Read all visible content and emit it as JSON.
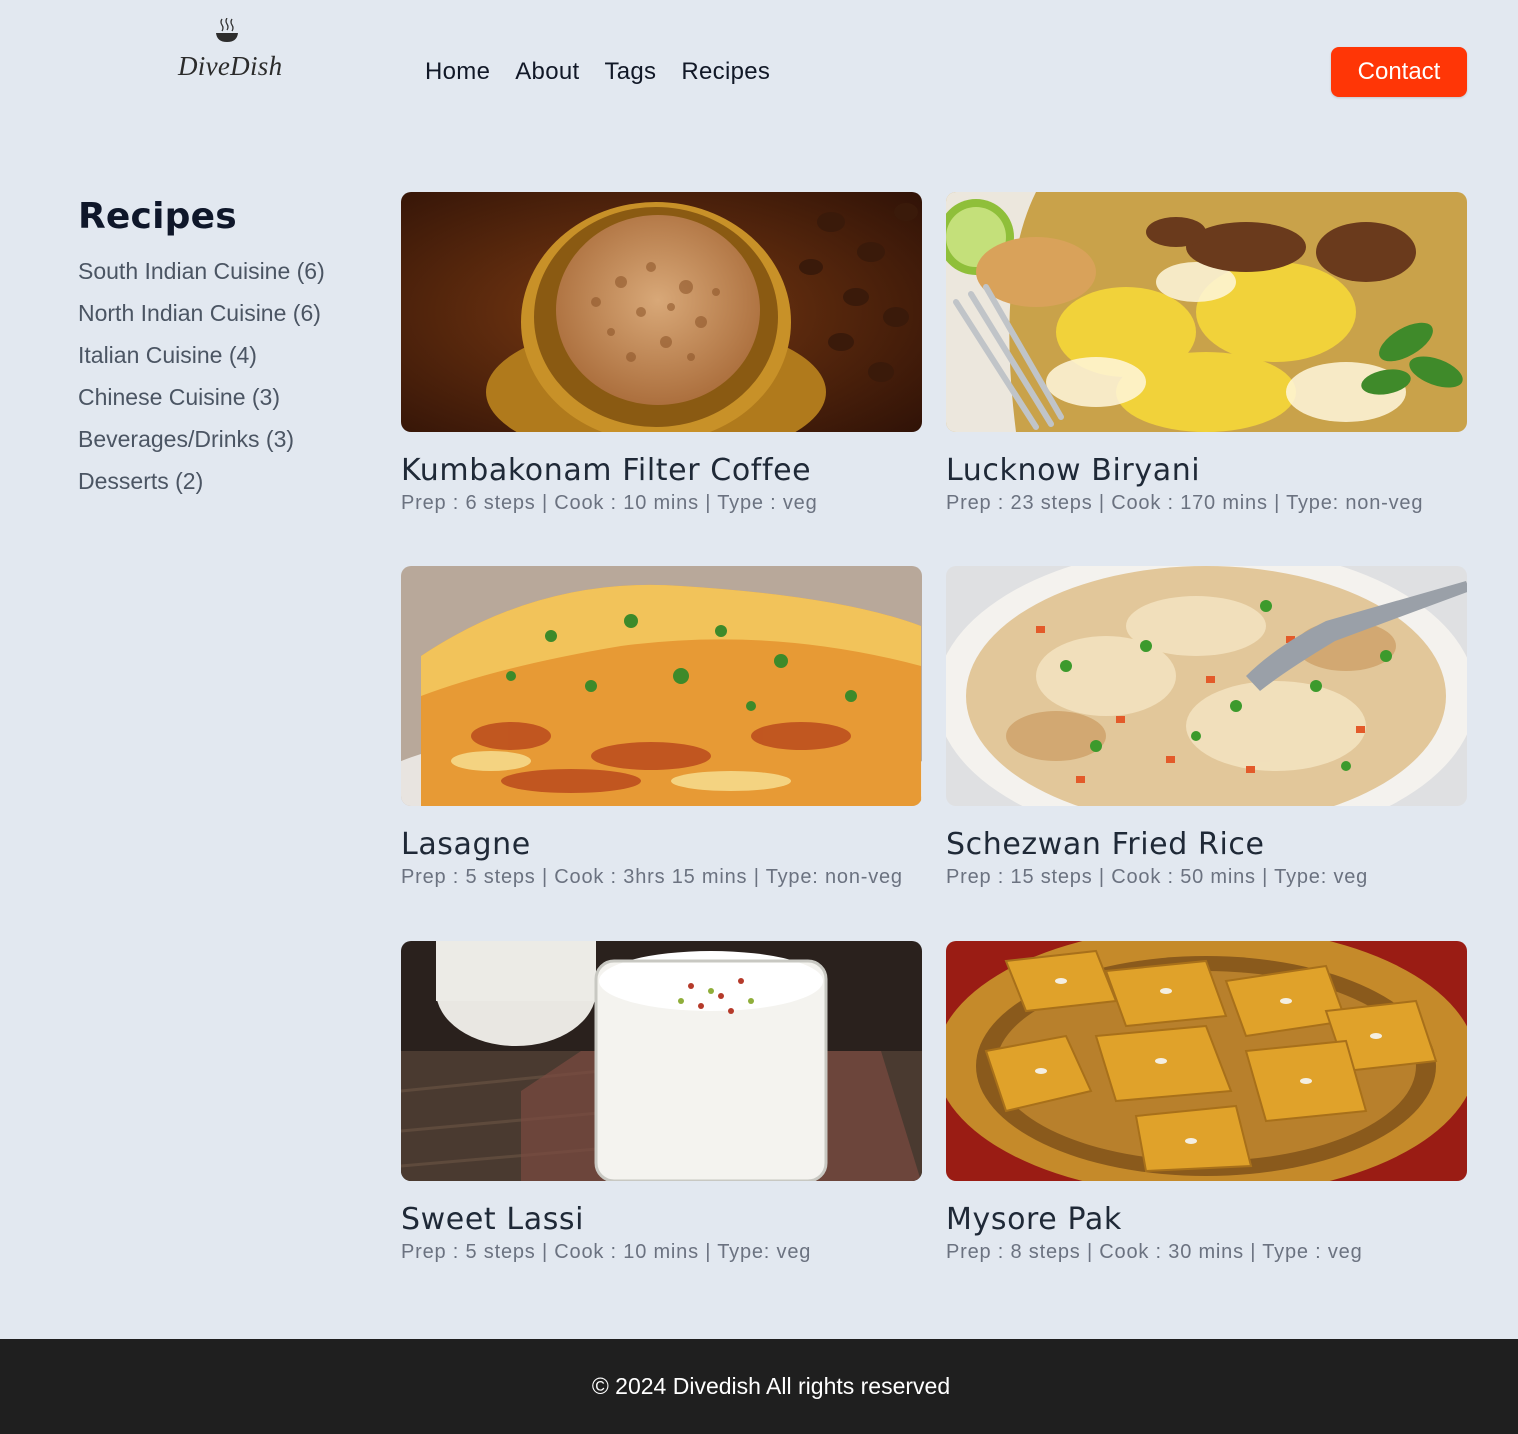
{
  "header": {
    "logo_text": "DiveDish",
    "nav": [
      "Home",
      "About",
      "Tags",
      "Recipes"
    ],
    "contact_label": "Contact"
  },
  "sidebar": {
    "title": "Recipes",
    "categories": [
      "South Indian Cuisine (6)",
      "North Indian Cuisine (6)",
      "Italian Cuisine (4)",
      "Chinese Cuisine (3)",
      "Beverages/Drinks (3)",
      "Desserts (2)"
    ]
  },
  "recipes": [
    {
      "title": "Kumbakonam Filter Coffee",
      "meta": "Prep : 6 steps | Cook : 10 mins | Type : veg",
      "image": "filter-coffee-image"
    },
    {
      "title": "Lucknow Biryani",
      "meta": "Prep : 23 steps | Cook : 170 mins | Type: non-veg",
      "image": "biryani-image"
    },
    {
      "title": "Lasagne",
      "meta": "Prep : 5 steps | Cook : 3hrs 15 mins | Type: non-veg",
      "image": "lasagne-image"
    },
    {
      "title": "Schezwan Fried Rice",
      "meta": "Prep : 15 steps | Cook : 50 mins | Type: veg",
      "image": "fried-rice-image"
    },
    {
      "title": "Sweet Lassi",
      "meta": "Prep : 5 steps | Cook : 10 mins | Type: veg",
      "image": "lassi-image"
    },
    {
      "title": "Mysore Pak",
      "meta": "Prep : 8 steps | Cook : 30 mins | Type : veg",
      "image": "mysore-pak-image"
    }
  ],
  "footer": {
    "text": "© 2024 Divedish All rights reserved"
  },
  "colors": {
    "background": "#e2e8f0",
    "accent": "#ff3606",
    "footer_bg": "#1f1f1f"
  }
}
